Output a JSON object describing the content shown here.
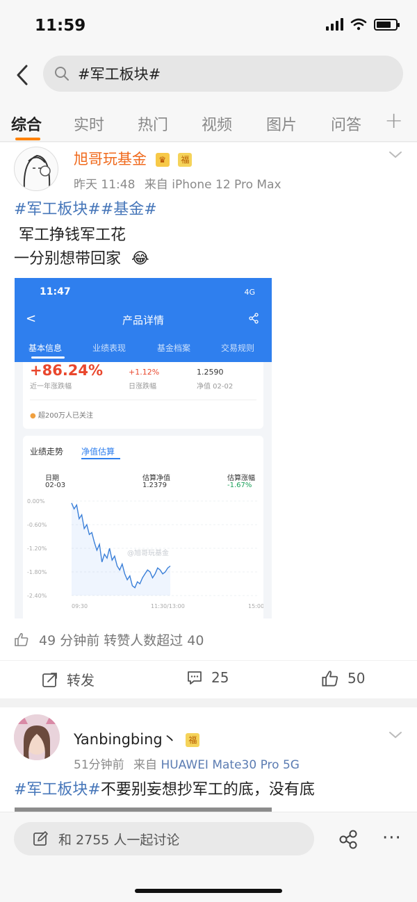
{
  "status": {
    "time": "11:59"
  },
  "search": {
    "query": "#军工板块#"
  },
  "tabs": [
    "综合",
    "实时",
    "热门",
    "视频",
    "图片",
    "问答"
  ],
  "tabs_plus": "+",
  "post1": {
    "user": "旭哥玩基金",
    "badge": "福",
    "time": "昨天 11:48",
    "source_prefix": "来自",
    "source": "iPhone 12 Pro Max",
    "hashtags": "#军工板块##基金#",
    "line1": " 军工挣钱军工花",
    "line2": "一分别想带回家",
    "emoji": "😂",
    "repost_info": "49 分钟前 转赞人数超过 40",
    "actions": {
      "repost": "转发",
      "comments": "25",
      "likes": "50"
    }
  },
  "screenshot": {
    "time": "11:47",
    "network": "4G",
    "title": "产品详情",
    "back": "<",
    "tabs": [
      "基本信息",
      "业绩表现",
      "基金档案",
      "交易规则"
    ],
    "pct_1y": "+86.24%",
    "pct_1y_label": "近一年涨跌幅",
    "day_change": "+1.12%",
    "day_change_label": "日涨跌幅",
    "nav": "1.2590",
    "nav_label": "净值 02-02",
    "followers": "超200万人已关注",
    "panel_tabs": [
      "业绩走势",
      "净值估算"
    ],
    "date_label": "日期",
    "date_val": "02-03",
    "est_nav_label": "估算净值",
    "est_nav_val": "1.2379",
    "est_chg_label": "估算涨幅",
    "est_chg_val": "-1.67%",
    "watermark": "@旭哥玩基金"
  },
  "chart_data": {
    "type": "line",
    "title": "",
    "xlabel": "",
    "ylabel": "",
    "y_ticks": [
      "0.00%",
      "-0.60%",
      "-1.20%",
      "-1.80%",
      "-2.40%"
    ],
    "x_ticks": [
      "09:30",
      "11:30/13:00",
      "15:00"
    ],
    "ylim": [
      -2.4,
      0.0
    ],
    "series": [
      {
        "values": [
          -0.05,
          -0.2,
          -0.1,
          -0.45,
          -0.35,
          -0.7,
          -0.6,
          -0.85,
          -0.8,
          -1.05,
          -1.25,
          -1.1,
          -1.55,
          -1.35,
          -1.45,
          -1.2,
          -1.5,
          -1.4,
          -1.65,
          -1.75,
          -1.6,
          -1.85,
          -2.0,
          -1.9,
          -2.15,
          -2.2,
          -2.05,
          -2.1,
          -1.95,
          -1.85,
          -1.75,
          -1.8,
          -1.95,
          -1.85,
          -1.7,
          -1.75,
          -1.85,
          -1.8,
          -1.7,
          -1.65
        ]
      }
    ]
  },
  "post2": {
    "user": "Yanbingbing丶",
    "badge": "福",
    "time": "51分钟前",
    "source_prefix": "来自",
    "source": "HUAWEI Mate30 Pro 5G",
    "hashtag": "#军工板块#",
    "text": "不要别妄想抄军工的底，没有底"
  },
  "bottom": {
    "discuss": "和 2755 人一起讨论",
    "more": "···"
  }
}
